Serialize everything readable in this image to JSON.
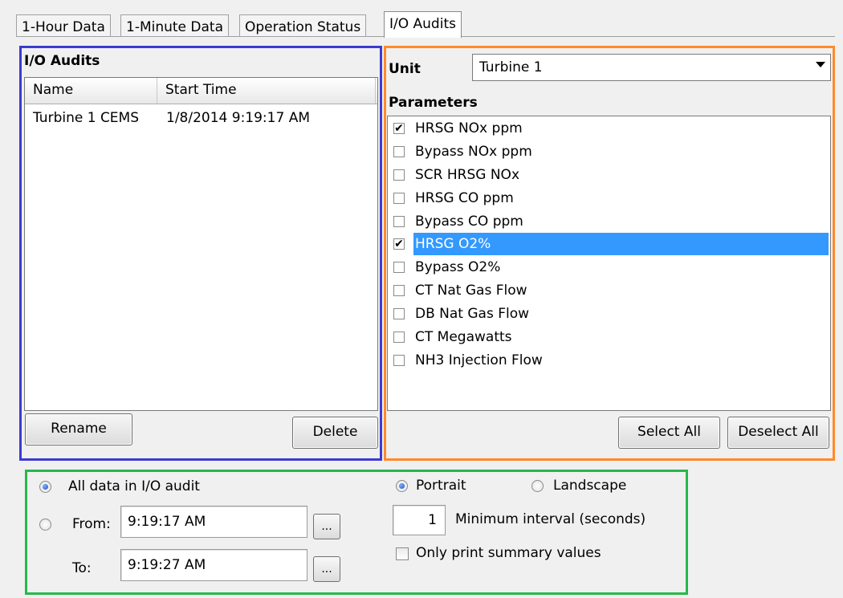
{
  "tabs": [
    {
      "label": "1-Hour Data"
    },
    {
      "label": "1-Minute Data"
    },
    {
      "label": "Operation Status"
    },
    {
      "label": "I/O Audits"
    }
  ],
  "audits": {
    "title": "I/O Audits",
    "columns": [
      "Name",
      "Start Time"
    ],
    "rows": [
      {
        "name": "Turbine 1 CEMS",
        "start_time": "1/8/2014 9:19:17 AM"
      }
    ],
    "rename_label": "Rename",
    "delete_label": "Delete"
  },
  "unit": {
    "label": "Unit",
    "selected": "Turbine 1"
  },
  "parameters": {
    "label": "Parameters",
    "items": [
      {
        "label": "HRSG NOx ppm",
        "checked": true
      },
      {
        "label": "Bypass NOx ppm",
        "checked": false
      },
      {
        "label": "SCR HRSG NOx",
        "checked": false
      },
      {
        "label": "HRSG CO ppm",
        "checked": false
      },
      {
        "label": "Bypass CO ppm",
        "checked": false
      },
      {
        "label": "HRSG O2%",
        "checked": true,
        "selected": true
      },
      {
        "label": "Bypass O2%",
        "checked": false
      },
      {
        "label": "CT Nat Gas Flow",
        "checked": false
      },
      {
        "label": "DB Nat Gas Flow",
        "checked": false
      },
      {
        "label": "CT Megawatts",
        "checked": false
      },
      {
        "label": "NH3 Injection Flow",
        "checked": false
      }
    ],
    "select_all_label": "Select All",
    "deselect_all_label": "Deselect All"
  },
  "range": {
    "all_data_label": "All data in I/O audit",
    "all_data_selected": true,
    "from_label": "From:",
    "from_value": "9:19:17 AM",
    "to_label": "To:",
    "to_value": "9:19:27 AM",
    "ellipsis": "..."
  },
  "print": {
    "portrait_label": "Portrait",
    "portrait_selected": true,
    "landscape_label": "Landscape",
    "min_interval_value": "1",
    "min_interval_label": "Minimum interval (seconds)",
    "summary_only_label": "Only print summary values",
    "summary_only_checked": false
  },
  "colors": {
    "audits_frame": "#3b3bd1",
    "parameters_frame": "#ff8a2a",
    "options_frame": "#26b84a",
    "selection": "#3399ff"
  }
}
